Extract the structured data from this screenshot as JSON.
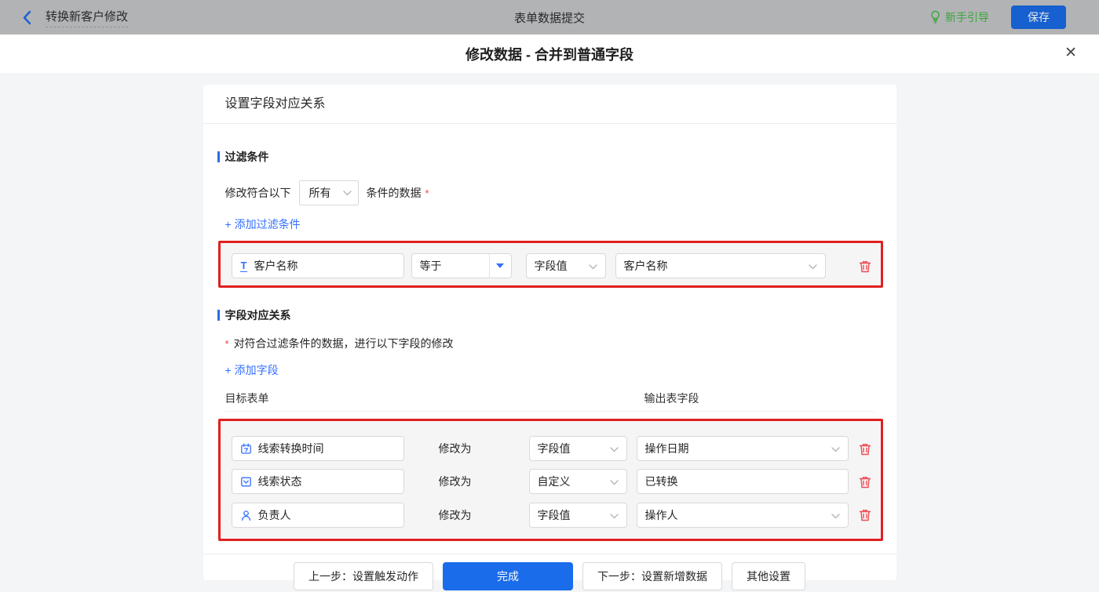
{
  "topbar": {
    "back_label": "转换新客户修改",
    "center_title": "表单数据提交",
    "guide_label": "新手引导",
    "save_label": "保存"
  },
  "modal": {
    "title": "修改数据 - 合并到普通字段",
    "close_glyph": "✕"
  },
  "card": {
    "header_title": "设置字段对应关系",
    "filter": {
      "section_title": "过滤条件",
      "match_prefix": "修改符合以下",
      "match_value": "所有",
      "match_suffix": "条件的数据",
      "required_mark": "*",
      "add_link": "+ 添加过滤条件",
      "condition": {
        "field": "客户名称",
        "operator": "等于",
        "value_type": "字段值",
        "value": "客户名称"
      }
    },
    "mapping": {
      "section_title": "字段对应关系",
      "required_mark": "*",
      "hint": "对符合过滤条件的数据，进行以下字段的修改",
      "add_link": "+ 添加字段",
      "columns": {
        "target": "目标表单",
        "output": "输出表字段"
      },
      "rows": [
        {
          "field": "线索转换时间",
          "icon": "calendar-icon",
          "modify_label": "修改为",
          "type": "字段值",
          "value": "操作日期"
        },
        {
          "field": "线索状态",
          "icon": "select-field-icon",
          "modify_label": "修改为",
          "type": "自定义",
          "value": "已转换"
        },
        {
          "field": "负责人",
          "icon": "person-icon",
          "modify_label": "修改为",
          "type": "字段值",
          "value": "操作人"
        }
      ]
    },
    "footer": {
      "prev": "上一步：设置触发动作",
      "done": "完成",
      "next": "下一步：设置新增数据",
      "other": "其他设置"
    }
  },
  "colors": {
    "accent_blue": "#3370ff",
    "done_blue": "#1a6cea",
    "save_blue": "#1760cf",
    "guide_green": "#3ca63c",
    "annotation_red": "#e02020",
    "trash_red": "#ee4a54",
    "topbar_gray": "#b1b3b5"
  }
}
